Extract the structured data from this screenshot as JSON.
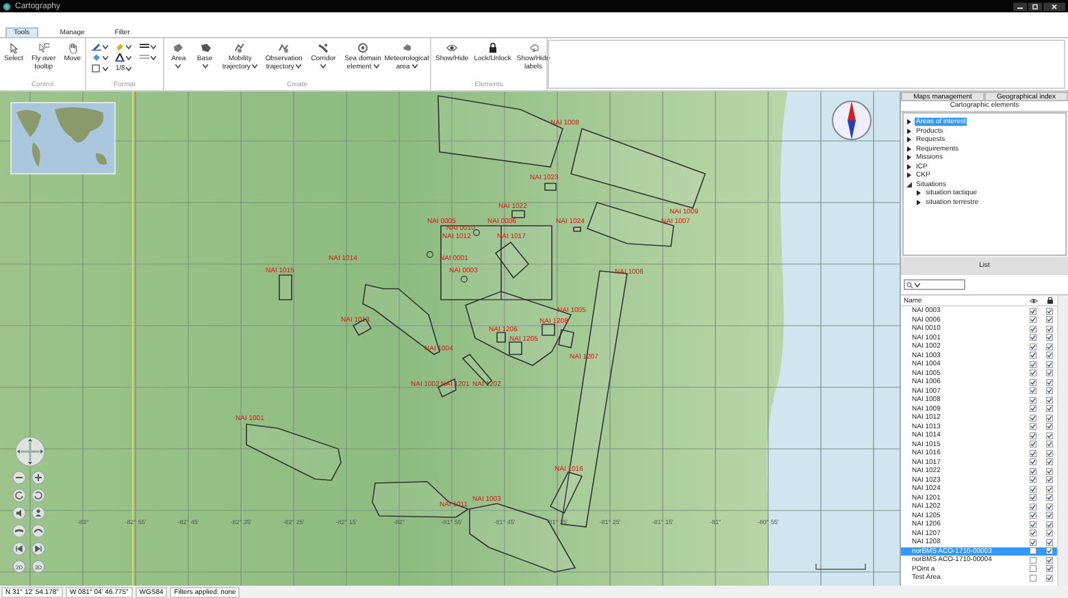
{
  "window": {
    "title": "Cartography"
  },
  "ribbon": {
    "tabs": [
      {
        "label": "Tools",
        "selected": true
      },
      {
        "label": "Manage",
        "selected": false
      },
      {
        "label": "Filter",
        "selected": false
      }
    ],
    "groups": [
      {
        "label": "Control",
        "kind": "buttons",
        "tools": [
          {
            "label": "Select",
            "dropdown": false
          },
          {
            "label": "Fly over tooltip",
            "dropdown": false
          },
          {
            "label": "Move",
            "dropdown": false
          }
        ]
      },
      {
        "label": "Format",
        "kind": "format",
        "line_width": "1/8"
      },
      {
        "label": "Create",
        "kind": "buttons",
        "tools": [
          {
            "label": "Area",
            "dropdown": true
          },
          {
            "label": "Base",
            "dropdown": true
          },
          {
            "label": "Mobility trajectory",
            "dropdown": true
          },
          {
            "label": "Observation trajectory",
            "dropdown": true
          },
          {
            "label": "Corridor",
            "dropdown": true
          },
          {
            "label": "Sea domain element",
            "dropdown": true
          },
          {
            "label": "Meteorological area",
            "dropdown": true
          }
        ]
      },
      {
        "label": "Elements",
        "kind": "buttons",
        "tools": [
          {
            "label": "Show/Hide",
            "dropdown": false
          },
          {
            "label": "Lock/Unlock",
            "dropdown": false
          },
          {
            "label": "Show/Hide labels",
            "dropdown": false
          }
        ]
      }
    ]
  },
  "map": {
    "areas": [
      {
        "label": "NAI 1008"
      },
      {
        "label": "NAI 1023"
      },
      {
        "label": "NAI 1022"
      },
      {
        "label": "NAI 1009"
      },
      {
        "label": "NAI 0005"
      },
      {
        "label": "NAI 0006"
      },
      {
        "label": "NAI 1024"
      },
      {
        "label": "NAI 1007"
      },
      {
        "label": "NAI 0010"
      },
      {
        "label": "NAI 1012"
      },
      {
        "label": "NAI 1017"
      },
      {
        "label": "NAI 1014"
      },
      {
        "label": "NAI 0001"
      },
      {
        "label": "NAI 1015"
      },
      {
        "label": "NAI 0003"
      },
      {
        "label": "NAI 1006"
      },
      {
        "label": "NAI 1005"
      },
      {
        "label": "NAI 1013"
      },
      {
        "label": "NAI 1208"
      },
      {
        "label": "NAI 1206"
      },
      {
        "label": "NAI 1205"
      },
      {
        "label": "NAI 1004"
      },
      {
        "label": "NAI 1207"
      },
      {
        "label": "NAI 1002"
      },
      {
        "label": "NAI 1201"
      },
      {
        "label": "NAI 1202"
      },
      {
        "label": "NAI 1001"
      },
      {
        "label": "NAI 1016"
      },
      {
        "label": "NAI 1011"
      },
      {
        "label": "NAI 1003"
      }
    ],
    "longitudes": [
      "-83°",
      "-82° 55'",
      "-82° 45'",
      "-82° 35'",
      "-82° 25'",
      "-82° 15'",
      "-82°",
      "-81° 55'",
      "-81° 45'",
      "-81° 35'",
      "-81° 25'",
      "-81° 15'",
      "-81°",
      "-80° 55'"
    ],
    "view_modes": [
      "2D",
      "3D"
    ]
  },
  "side_panel": {
    "tabs": [
      {
        "label": "Maps management",
        "selected": false
      },
      {
        "label": "Geographical index",
        "selected": false
      }
    ],
    "tree_title": "Cartographic elements",
    "tree": [
      {
        "label": "Areas of interest",
        "selected": true,
        "expanded": false
      },
      {
        "label": "Products",
        "selected": false,
        "expanded": false
      },
      {
        "label": "Requests",
        "selected": false,
        "expanded": false
      },
      {
        "label": "Requirements",
        "selected": false,
        "expanded": false
      },
      {
        "label": "Missions",
        "selected": false,
        "expanded": false
      },
      {
        "label": "ICP",
        "selected": false,
        "expanded": false
      },
      {
        "label": "CKP",
        "selected": false,
        "expanded": false
      },
      {
        "label": "Situations",
        "selected": false,
        "expanded": true,
        "children": [
          {
            "label": "situation tactique",
            "selected": false,
            "expanded": false
          },
          {
            "label": "situation terrestre",
            "selected": false,
            "expanded": false
          }
        ]
      }
    ],
    "list_title": "List",
    "column": "Name",
    "rows": [
      {
        "name": "NAI 0003",
        "visible": true,
        "locked": true,
        "selected": false
      },
      {
        "name": "NAI 0006",
        "visible": true,
        "locked": true,
        "selected": false
      },
      {
        "name": "NAI 0010",
        "visible": true,
        "locked": true,
        "selected": false
      },
      {
        "name": "NAI 1001",
        "visible": true,
        "locked": true,
        "selected": false
      },
      {
        "name": "NAI 1002",
        "visible": true,
        "locked": true,
        "selected": false
      },
      {
        "name": "NAI 1003",
        "visible": true,
        "locked": true,
        "selected": false
      },
      {
        "name": "NAI 1004",
        "visible": true,
        "locked": true,
        "selected": false
      },
      {
        "name": "NAI 1005",
        "visible": true,
        "locked": true,
        "selected": false
      },
      {
        "name": "NAI 1006",
        "visible": true,
        "locked": true,
        "selected": false
      },
      {
        "name": "NAI 1007",
        "visible": true,
        "locked": true,
        "selected": false
      },
      {
        "name": "NAI 1008",
        "visible": true,
        "locked": true,
        "selected": false
      },
      {
        "name": "NAI 1009",
        "visible": true,
        "locked": true,
        "selected": false
      },
      {
        "name": "NAI 1012",
        "visible": true,
        "locked": true,
        "selected": false
      },
      {
        "name": "NAI 1013",
        "visible": true,
        "locked": true,
        "selected": false
      },
      {
        "name": "NAI 1014",
        "visible": true,
        "locked": true,
        "selected": false
      },
      {
        "name": "NAI 1015",
        "visible": true,
        "locked": true,
        "selected": false
      },
      {
        "name": "NAI 1016",
        "visible": true,
        "locked": true,
        "selected": false
      },
      {
        "name": "NAI 1017",
        "visible": true,
        "locked": true,
        "selected": false
      },
      {
        "name": "NAI 1022",
        "visible": true,
        "locked": true,
        "selected": false
      },
      {
        "name": "NAI 1023",
        "visible": true,
        "locked": true,
        "selected": false
      },
      {
        "name": "NAI 1024",
        "visible": true,
        "locked": true,
        "selected": false
      },
      {
        "name": "NAI 1201",
        "visible": true,
        "locked": true,
        "selected": false
      },
      {
        "name": "NAI 1202",
        "visible": true,
        "locked": true,
        "selected": false
      },
      {
        "name": "NAI 1205",
        "visible": true,
        "locked": true,
        "selected": false
      },
      {
        "name": "NAI 1206",
        "visible": true,
        "locked": true,
        "selected": false
      },
      {
        "name": "NAI 1207",
        "visible": true,
        "locked": true,
        "selected": false
      },
      {
        "name": "NAI 1208",
        "visible": true,
        "locked": true,
        "selected": false
      },
      {
        "name": "norBMS ACO-1710-00003",
        "visible": false,
        "locked": true,
        "selected": true
      },
      {
        "name": "norBMS ACO-1710-00004",
        "visible": false,
        "locked": true,
        "selected": false
      },
      {
        "name": "POint a",
        "visible": false,
        "locked": true,
        "selected": false
      },
      {
        "name": "Test Area",
        "visible": false,
        "locked": true,
        "selected": false
      }
    ]
  },
  "status_bar": [
    "N 31° 12' 54.178\"",
    "W 081° 04' 46.775\"",
    "WGS84",
    "Filters applied: none"
  ]
}
